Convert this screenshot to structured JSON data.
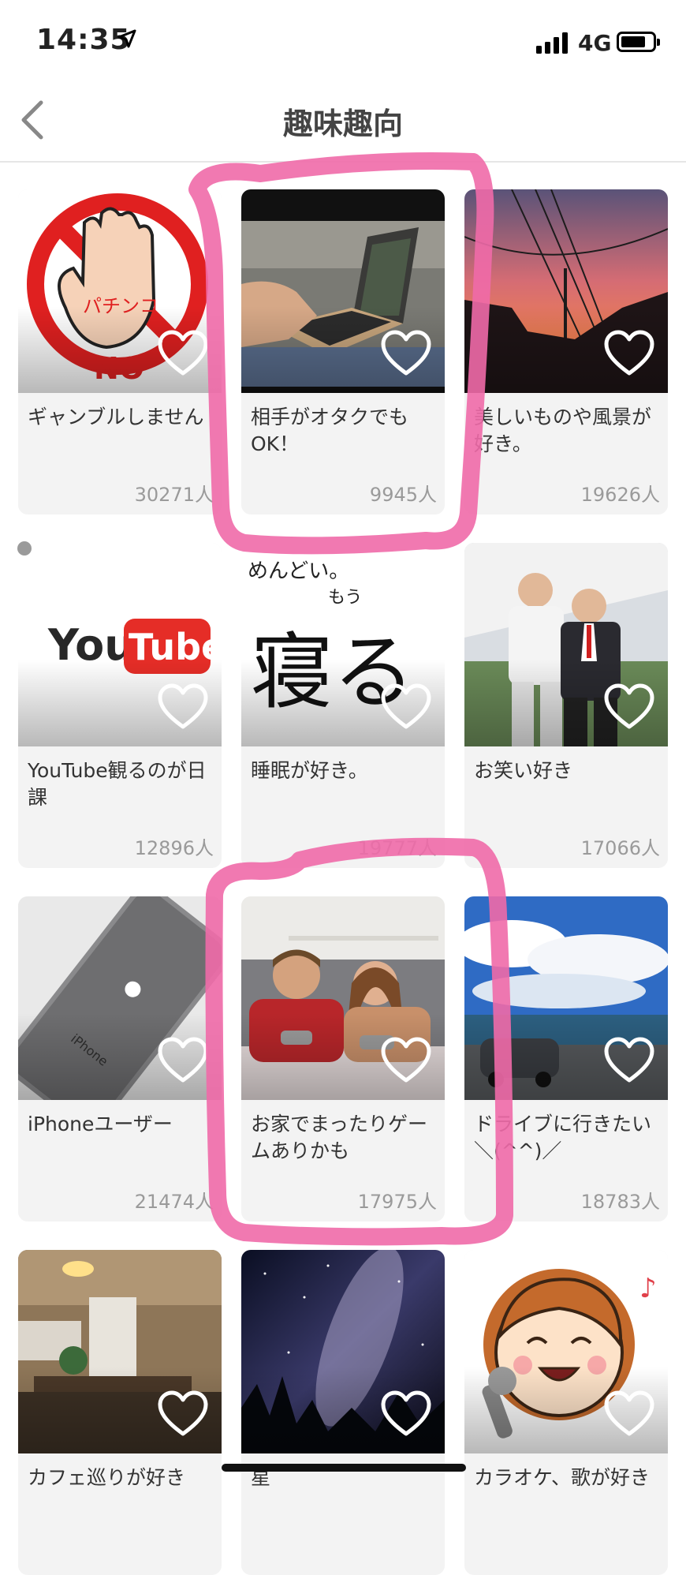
{
  "status_bar": {
    "time": "14:35",
    "network": "4G"
  },
  "nav": {
    "title": "趣味趣向"
  },
  "cards": [
    {
      "label": "ギャンブルしません",
      "count": "30271人"
    },
    {
      "label": "相手がオタクでもOK！",
      "count": "9945人"
    },
    {
      "label": "美しいものや風景が好き。",
      "count": "19626人"
    },
    {
      "label": "YouTube観るのが日課",
      "count": "12896人"
    },
    {
      "label": "睡眠が好き。",
      "count": "19777人"
    },
    {
      "label": "お笑い好き",
      "count": "17066人"
    },
    {
      "label": "iPhoneユーザー",
      "count": "21474人"
    },
    {
      "label": "お家でまったりゲームありかも",
      "count": "17975人"
    },
    {
      "label": "ドライブに行きたい＼(^^)／",
      "count": "18783人"
    },
    {
      "label": "カフェ巡りが好き",
      "count": ""
    },
    {
      "label": "星",
      "count": ""
    },
    {
      "label": "カラオケ、歌が好き",
      "count": ""
    }
  ],
  "image_text": {
    "pachinko": "パチンコ",
    "no": "NO",
    "youtube_you": "You",
    "youtube_tube": "Tube",
    "sleep_line1": "めんどい。",
    "sleep_line2": "もう",
    "sleep_big": "寝る",
    "iphone": "iPhone"
  },
  "colors": {
    "annotation_pink": "#f06aa8",
    "no_red": "#e02020",
    "youtube_red": "#e52d27"
  }
}
